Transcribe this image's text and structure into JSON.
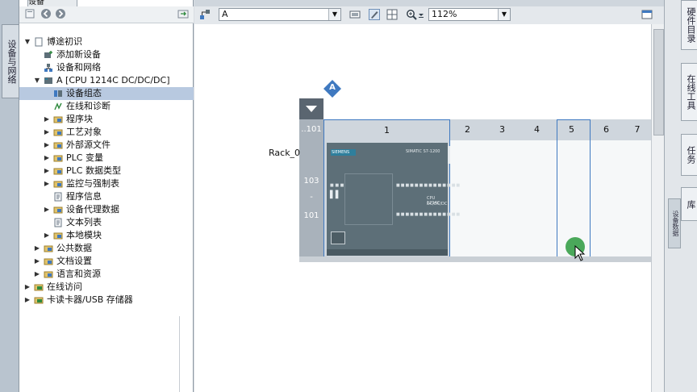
{
  "left_strip": {
    "tab_label": "设备与网络"
  },
  "tree_panel": {
    "header_tab": "设备",
    "items": [
      {
        "label": "博途初识",
        "level": 0,
        "expanded": true,
        "icon": "project-icon"
      },
      {
        "label": "添加新设备",
        "level": 1,
        "icon": "add-device-icon"
      },
      {
        "label": "设备和网络",
        "level": 1,
        "icon": "network-icon"
      },
      {
        "label": "A [CPU 1214C DC/DC/DC]",
        "level": 1,
        "expanded": true,
        "icon": "plc-icon"
      },
      {
        "label": "设备组态",
        "level": 2,
        "icon": "device-config-icon",
        "selected": true
      },
      {
        "label": "在线和诊断",
        "level": 2,
        "icon": "online-diagnostics-icon"
      },
      {
        "label": "程序块",
        "level": 2,
        "collapsed": true,
        "icon": "folder-icon"
      },
      {
        "label": "工艺对象",
        "level": 2,
        "collapsed": true,
        "icon": "folder-icon"
      },
      {
        "label": "外部源文件",
        "level": 2,
        "collapsed": true,
        "icon": "folder-icon"
      },
      {
        "label": "PLC 变量",
        "level": 2,
        "collapsed": true,
        "icon": "folder-icon"
      },
      {
        "label": "PLC 数据类型",
        "level": 2,
        "collapsed": true,
        "icon": "folder-icon"
      },
      {
        "label": "监控与强制表",
        "level": 2,
        "collapsed": true,
        "icon": "folder-icon"
      },
      {
        "label": "程序信息",
        "level": 2,
        "icon": "program-info-icon"
      },
      {
        "label": "设备代理数据",
        "level": 2,
        "collapsed": true,
        "icon": "folder-icon"
      },
      {
        "label": "文本列表",
        "level": 2,
        "icon": "text-list-icon"
      },
      {
        "label": "本地模块",
        "level": 2,
        "collapsed": true,
        "icon": "folder-icon"
      },
      {
        "label": "公共数据",
        "level": 1,
        "collapsed": true,
        "icon": "folder-icon"
      },
      {
        "label": "文档设置",
        "level": 1,
        "collapsed": true,
        "icon": "folder-icon"
      },
      {
        "label": "语言和资源",
        "level": 1,
        "collapsed": true,
        "icon": "folder-icon"
      },
      {
        "label": "在线访问",
        "level": 0,
        "collapsed": true,
        "icon": "online-access-icon"
      },
      {
        "label": "卡读卡器/USB 存储器",
        "level": 0,
        "collapsed": true,
        "icon": "card-reader-icon"
      }
    ]
  },
  "main_toolbar": {
    "device_combo": "A",
    "zoom_combo": "112%"
  },
  "rack": {
    "name": "Rack_0",
    "left_header": "..101",
    "left_labels": [
      "103",
      "-",
      "101"
    ],
    "slots": [
      "1",
      "2",
      "3",
      "4",
      "5",
      "6",
      "7"
    ],
    "cpu_brand": "SIEMENS",
    "cpu_series": "SIMATIC S7-1200",
    "cpu_model": "CPU 1214C",
    "cpu_model_sub": "DC/DC/DC",
    "station_badge": "A"
  },
  "right_strip": {
    "tabs": [
      "硬件目录",
      "在线工具",
      "任务",
      "库"
    ],
    "narrow_tab": "设备数据"
  },
  "colors": {
    "selection_blue": "#3f79c0",
    "cpu_gray": "#5d6f78",
    "cursor_green": "#4aa85a"
  }
}
